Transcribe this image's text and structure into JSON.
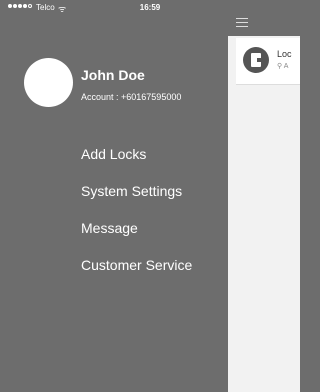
{
  "status_bar": {
    "carrier": "Telco",
    "time": "16:59",
    "wifi_icon": "wifi-icon",
    "signal_dots": 5
  },
  "drawer": {
    "user": {
      "name": "John Doe",
      "account": "Account : +60167595000"
    },
    "menu": [
      {
        "label": "Add Locks"
      },
      {
        "label": "System Settings"
      },
      {
        "label": "Message"
      },
      {
        "label": "Customer Service"
      }
    ]
  },
  "content": {
    "menu_icon": "hamburger-menu-icon",
    "lock_card": {
      "name": "Loc",
      "sub_label": "A",
      "icon": "lock-icon",
      "user_icon": "user-icon"
    }
  },
  "colors": {
    "drawer_bg": "#6d6d6d",
    "content_bg": "#f2f2f2",
    "text_light": "#ffffff"
  }
}
